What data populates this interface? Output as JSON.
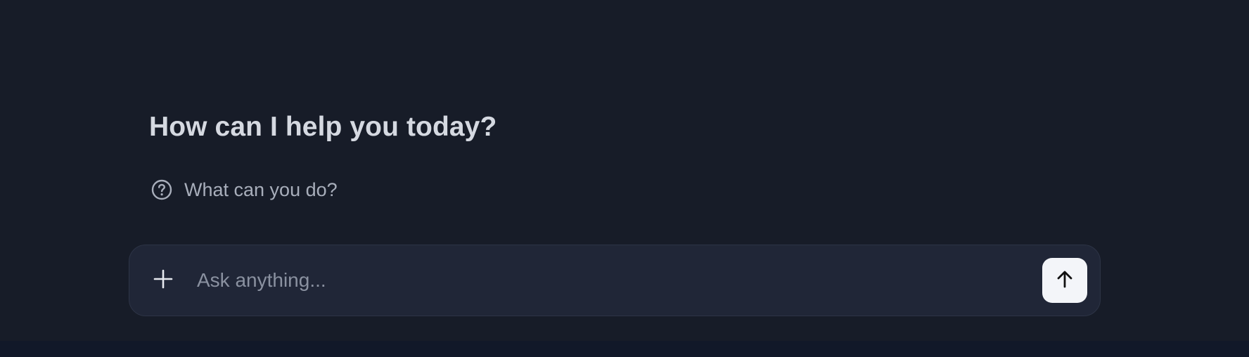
{
  "chat": {
    "greeting": "How can I help you today?",
    "suggestions": [
      {
        "icon": "question-circle-icon",
        "label": "What can you do?"
      }
    ]
  },
  "composer": {
    "placeholder": "Ask anything...",
    "value": "",
    "attach_icon": "plus-icon",
    "send_icon": "arrow-up-icon"
  },
  "colors": {
    "background": "#171c28",
    "composer_background": "#202637",
    "send_button_background": "#f3f5f9",
    "footer_background": "#111829"
  }
}
